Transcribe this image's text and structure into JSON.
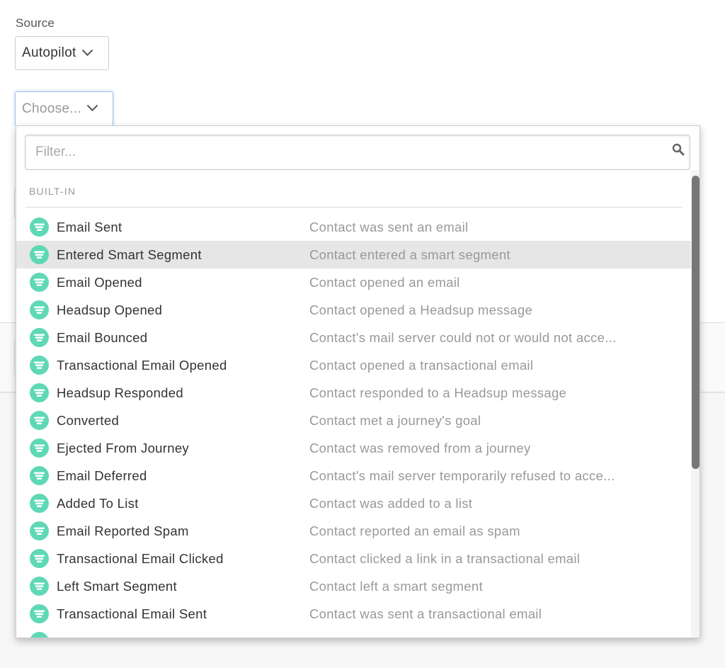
{
  "source": {
    "label": "Source",
    "selected": "Autopilot"
  },
  "trigger_select": {
    "placeholder": "Choose..."
  },
  "dropdown": {
    "filter_placeholder": "Filter...",
    "group_header": "BUILT-IN",
    "highlighted_index": 1,
    "icon": "funnel-icon",
    "icon_color": "#5fd8b6",
    "scrollbar_thumb_color": "#777777",
    "items": [
      {
        "name": "Email Sent",
        "desc": "Contact was sent an email"
      },
      {
        "name": "Entered Smart Segment",
        "desc": "Contact entered a smart segment"
      },
      {
        "name": "Email Opened",
        "desc": "Contact opened an email"
      },
      {
        "name": "Headsup Opened",
        "desc": "Contact opened a Headsup message"
      },
      {
        "name": "Email Bounced",
        "desc": "Contact's mail server could not or would not acce..."
      },
      {
        "name": "Transactional Email Opened",
        "desc": "Contact opened a transactional email"
      },
      {
        "name": "Headsup Responded",
        "desc": "Contact responded to a Headsup message"
      },
      {
        "name": "Converted",
        "desc": "Contact met a journey's goal"
      },
      {
        "name": "Ejected From Journey",
        "desc": "Contact was removed from a journey"
      },
      {
        "name": "Email Deferred",
        "desc": "Contact's mail server temporarily refused to acce..."
      },
      {
        "name": "Added To List",
        "desc": "Contact was added to a list"
      },
      {
        "name": "Email Reported Spam",
        "desc": "Contact reported an email as spam"
      },
      {
        "name": "Transactional Email Clicked",
        "desc": "Contact clicked a link in a transactional email"
      },
      {
        "name": "Left Smart Segment",
        "desc": "Contact left a smart segment"
      },
      {
        "name": "Transactional Email Sent",
        "desc": "Contact was sent a transactional email"
      },
      {
        "name": "",
        "desc": ""
      }
    ]
  }
}
